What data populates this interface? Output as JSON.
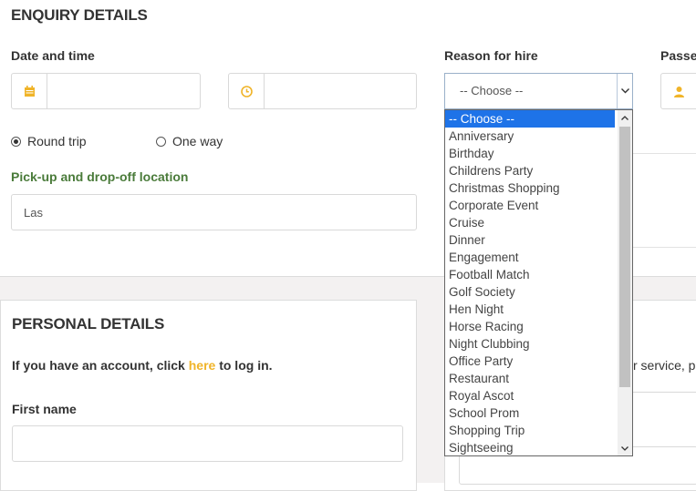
{
  "enquiry": {
    "title": "ENQUIRY DETAILS",
    "date_time_label": "Date and time",
    "date_value": "",
    "time_value": "",
    "reason_label": "Reason for hire",
    "reason_selected": "-- Choose --",
    "passengers_label": "Passe",
    "trip": {
      "round_trip": "Round trip",
      "one_way": "One way",
      "selected": "round_trip"
    },
    "location_label": "Pick-up and drop-off location",
    "location_value": "Las"
  },
  "reason_options": [
    "-- Choose --",
    "Anniversary",
    "Birthday",
    "Childrens Party",
    "Christmas Shopping",
    "Corporate Event",
    "Cruise",
    "Dinner",
    "Engagement",
    "Football Match",
    "Golf Society",
    "Hen Night",
    "Horse Racing",
    "Night Clubbing",
    "Office Party",
    "Restaurant",
    "Royal Ascot",
    "School Prom",
    "Shopping Trip",
    "Sightseeing"
  ],
  "personal": {
    "title": "PERSONAL DETAILS",
    "account_prefix": "If you have an account, click ",
    "account_link": "here",
    "account_suffix": " to log in.",
    "first_name_label": "First name",
    "first_name_value": ""
  },
  "right_panel": {
    "partial_text": "r service, p"
  },
  "colors": {
    "accent": "#f0b429",
    "green": "#4a7b3a",
    "selection": "#1e73e8"
  },
  "icons": {
    "date": "calendar-icon",
    "time": "clock-icon",
    "passengers": "user-icon",
    "select": "chevron-down-icon"
  }
}
